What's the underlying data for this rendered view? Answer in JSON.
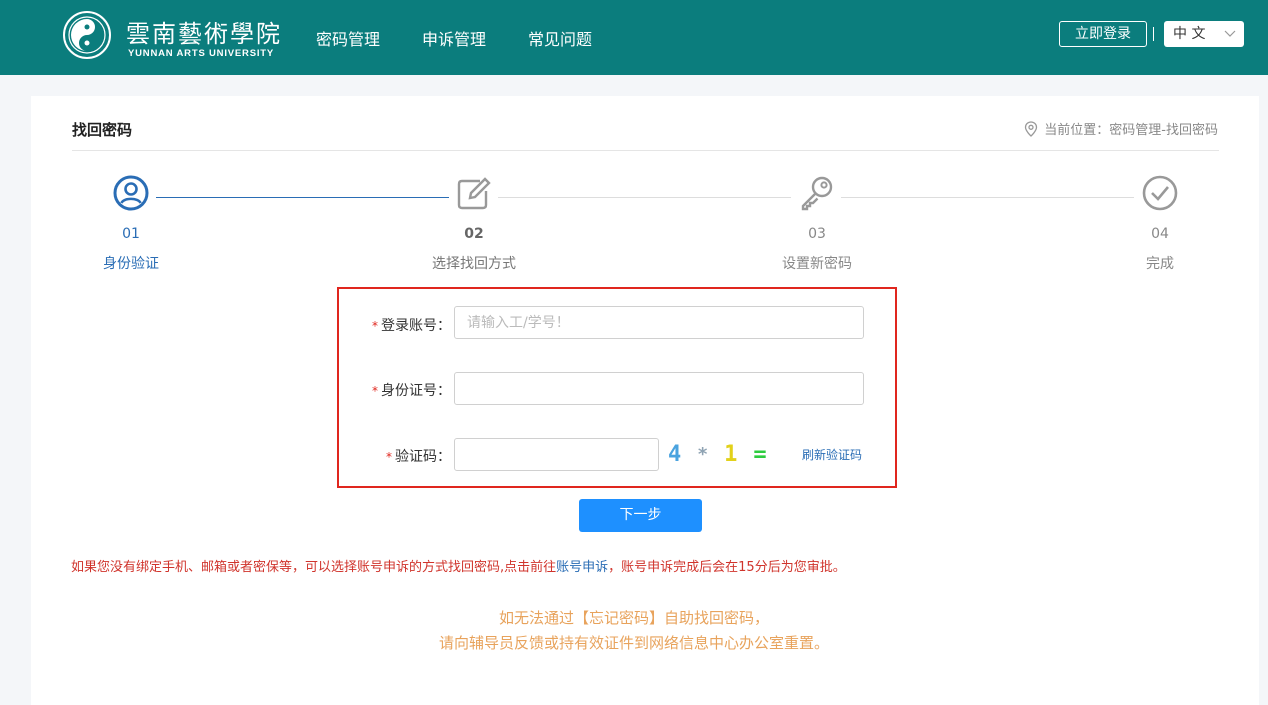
{
  "header": {
    "logo_cn": "雲南藝術學院",
    "logo_en": "YUNNAN ARTS UNIVERSITY",
    "nav": [
      "密码管理",
      "申诉管理",
      "常见问题"
    ],
    "login_label": "立即登录",
    "lang_label": "中 文",
    "bg_color": "#0b7d7d"
  },
  "page": {
    "title": "找回密码",
    "location": "当前位置：密码管理-找回密码",
    "location_icon": "map-pin-icon"
  },
  "steps": [
    {
      "num": "01",
      "label": "身份验证",
      "icon": "user-circle-icon",
      "active": true
    },
    {
      "num": "02",
      "label": "选择找回方式",
      "icon": "edit-icon",
      "active": false
    },
    {
      "num": "03",
      "label": "设置新密码",
      "icon": "key-icon",
      "active": false
    },
    {
      "num": "04",
      "label": "完成",
      "icon": "check-circle-icon",
      "active": false
    }
  ],
  "form": {
    "fields": [
      {
        "label": "登录账号：",
        "placeholder": "请输入工/学号！",
        "value": ""
      },
      {
        "label": "身份证号：",
        "placeholder": "",
        "value": ""
      },
      {
        "label": "验证码：",
        "placeholder": "",
        "value": ""
      }
    ],
    "captcha": [
      "4",
      "*",
      "1",
      "="
    ],
    "captcha_colors": [
      "#4aa3df",
      "#8fa3b3",
      "#e2d11a",
      "#2ecc40"
    ],
    "refresh_label": "刷新验证码"
  },
  "next_label": "下一步",
  "notice": {
    "prefix": "如果您没有绑定手机、邮箱或者密保等，可以选择账号申诉的方式找回密码,点击前往",
    "link": "账号申诉",
    "suffix": "，账号申诉完成后会在15分后为您审批。"
  },
  "footer": {
    "line1": "如无法通过【忘记密码】自助找回密码，",
    "line2": "请向辅导员反馈或持有效证件到网络信息中心办公室重置。"
  }
}
